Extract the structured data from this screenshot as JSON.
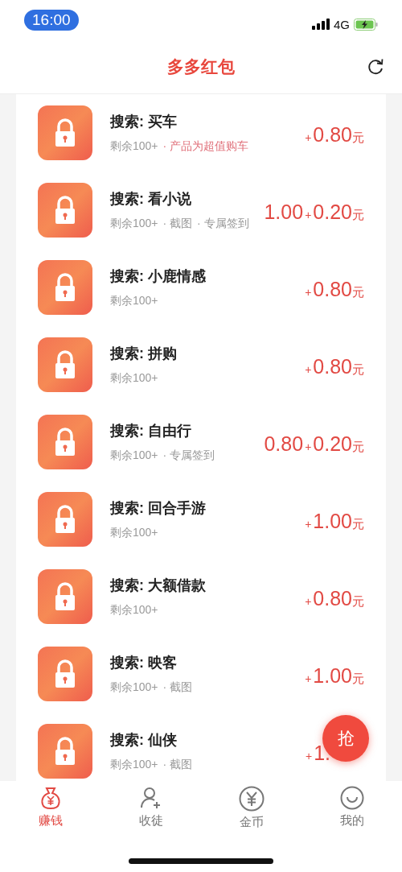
{
  "status_bar": {
    "time": "16:00",
    "network": "4G"
  },
  "header": {
    "title": "多多红包"
  },
  "tasks": [
    {
      "title": "搜索: 买车",
      "tags": [
        {
          "text": "剩余100+",
          "highlight": false
        },
        {
          "text": "· 产品为超值购车",
          "highlight": true
        }
      ],
      "reward": {
        "plus": "+",
        "amount": "0.80",
        "unit": "元"
      }
    },
    {
      "title": "搜索: 看小说",
      "tags": [
        {
          "text": "剩余100+",
          "highlight": false
        },
        {
          "text": "· 截图",
          "highlight": false
        },
        {
          "text": "· 专属签到",
          "highlight": false
        }
      ],
      "reward": {
        "base": "1.00",
        "plus": "+",
        "amount": "0.20",
        "unit": "元"
      }
    },
    {
      "title": "搜索: 小鹿情感",
      "tags": [
        {
          "text": "剩余100+",
          "highlight": false
        }
      ],
      "reward": {
        "plus": "+",
        "amount": "0.80",
        "unit": "元"
      }
    },
    {
      "title": "搜索: 拼购",
      "tags": [
        {
          "text": "剩余100+",
          "highlight": false
        }
      ],
      "reward": {
        "plus": "+",
        "amount": "0.80",
        "unit": "元"
      }
    },
    {
      "title": "搜索: 自由行",
      "tags": [
        {
          "text": "剩余100+",
          "highlight": false
        },
        {
          "text": "· 专属签到",
          "highlight": false
        }
      ],
      "reward": {
        "base": "0.80",
        "plus": "+",
        "amount": "0.20",
        "unit": "元"
      }
    },
    {
      "title": "搜索: 回合手游",
      "tags": [
        {
          "text": "剩余100+",
          "highlight": false
        }
      ],
      "reward": {
        "plus": "+",
        "amount": "1.00",
        "unit": "元"
      }
    },
    {
      "title": "搜索: 大额借款",
      "tags": [
        {
          "text": "剩余100+",
          "highlight": false
        }
      ],
      "reward": {
        "plus": "+",
        "amount": "0.80",
        "unit": "元"
      }
    },
    {
      "title": "搜索: 映客",
      "tags": [
        {
          "text": "剩余100+",
          "highlight": false
        },
        {
          "text": "· 截图",
          "highlight": false
        }
      ],
      "reward": {
        "plus": "+",
        "amount": "1.00",
        "unit": "元"
      }
    },
    {
      "title": "搜索: 仙侠",
      "tags": [
        {
          "text": "剩余100+",
          "highlight": false
        },
        {
          "text": "· 截图",
          "highlight": false
        }
      ],
      "reward": {
        "plus": "+",
        "amount": "1."
      }
    }
  ],
  "fab": {
    "label": "抢"
  },
  "tab_bar": [
    {
      "label": "赚钱",
      "kind": "bag",
      "selected": true
    },
    {
      "label": "收徒",
      "kind": "person",
      "selected": false
    },
    {
      "label": "金币",
      "kind": "coin",
      "selected": false
    },
    {
      "label": "我的",
      "kind": "smile",
      "selected": false
    }
  ]
}
